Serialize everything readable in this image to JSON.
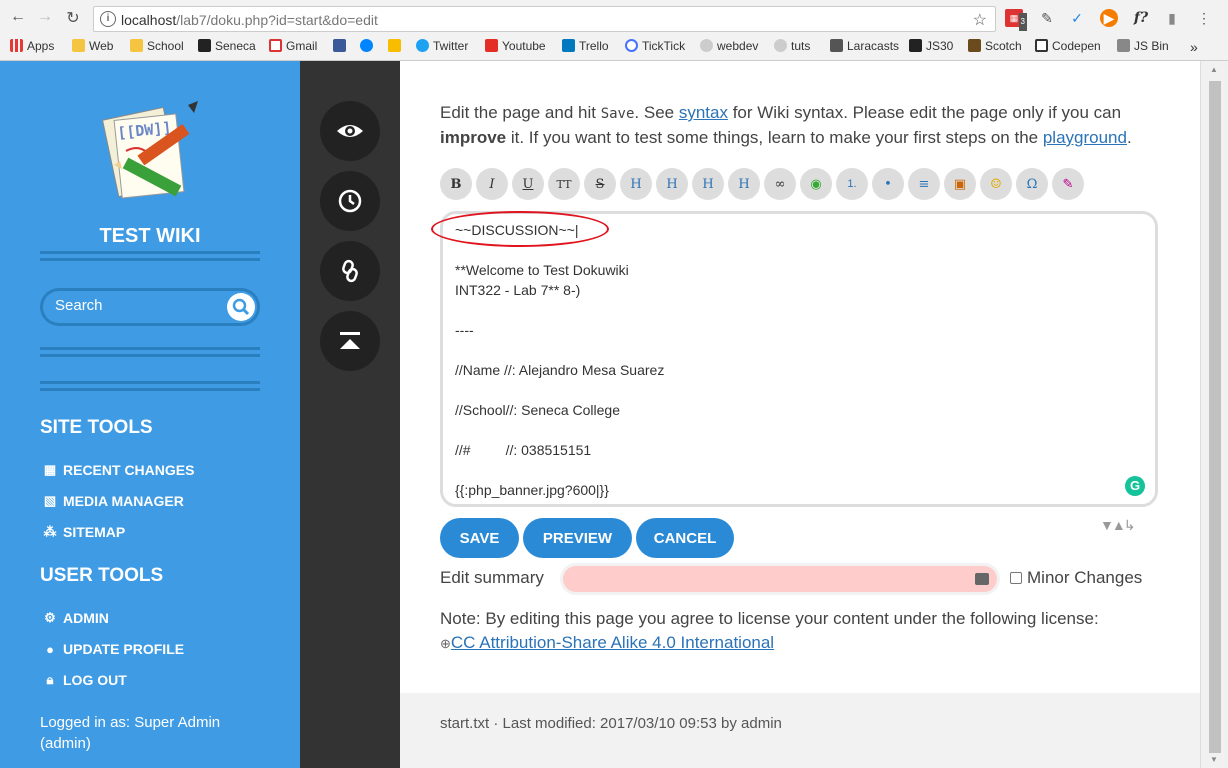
{
  "browser": {
    "url_host": "localhost",
    "url_path": "/lab7/doku.php?id=start&do=edit",
    "bookmarks": [
      "Apps",
      "Web",
      "School",
      "Seneca",
      "Gmail",
      "Twitter",
      "Youtube",
      "Trello",
      "TickTick",
      "webdev",
      "tuts",
      "Laracasts",
      "JS30",
      "Scotch",
      "Codepen",
      "JS Bin"
    ],
    "ext_badge": "3",
    "overflow": "»"
  },
  "sidebar": {
    "title": "TEST WIKI",
    "search_placeholder": "Search",
    "site_tools_heading": "SITE TOOLS",
    "site_tools": [
      "RECENT CHANGES",
      "MEDIA MANAGER",
      "SITEMAP"
    ],
    "user_tools_heading": "USER TOOLS",
    "user_tools": [
      "ADMIN",
      "UPDATE PROFILE",
      "LOG OUT"
    ],
    "logged_in_line1": "Logged in as: Super Admin",
    "logged_in_line2": "(admin)"
  },
  "content": {
    "intro_1": "Edit the page and hit ",
    "intro_save": "Save",
    "intro_2": ". See ",
    "intro_syntax": "syntax",
    "intro_3": " for Wiki syntax. Please edit the page only if you can ",
    "intro_improve": "improve",
    "intro_4": " it. If you want to test some things, learn to make your first steps on the ",
    "intro_playground": "playground",
    "intro_5": ".",
    "toolbar": [
      "B",
      "I",
      "U",
      "TT",
      "S",
      "H",
      "H",
      "H",
      "H",
      "∞",
      "◉",
      "1.",
      "•",
      "≡",
      "▣",
      "☺",
      "Ω",
      "✎"
    ],
    "editor_text": "~~DISCUSSION~~|\n\n**Welcome to Test Dokuwiki\nINT322 - Lab 7** 8-)\n\n----\n\n//Name //: Alejandro Mesa Suarez\n\n//School//: Seneca College\n\n//#         //: 038515151\n\n{{:php_banner.jpg?600|}}",
    "save": "SAVE",
    "preview": "PREVIEW",
    "cancel": "CANCEL",
    "summary_label": "Edit summary",
    "minor_label": "Minor Changes",
    "license_text": "Note: By editing this page you agree to license your content under the following license:",
    "license_link": "CC Attribution-Share Alike 4.0 International",
    "footer": "start.txt · Last modified: 2017/03/10 09:53 by admin"
  },
  "colors": {
    "sidebar": "#3e9be4",
    "pagetools": "#333333",
    "button": "#2b8ad6",
    "summary_bg": "#ffcccc",
    "annotation": "#e0141e"
  }
}
